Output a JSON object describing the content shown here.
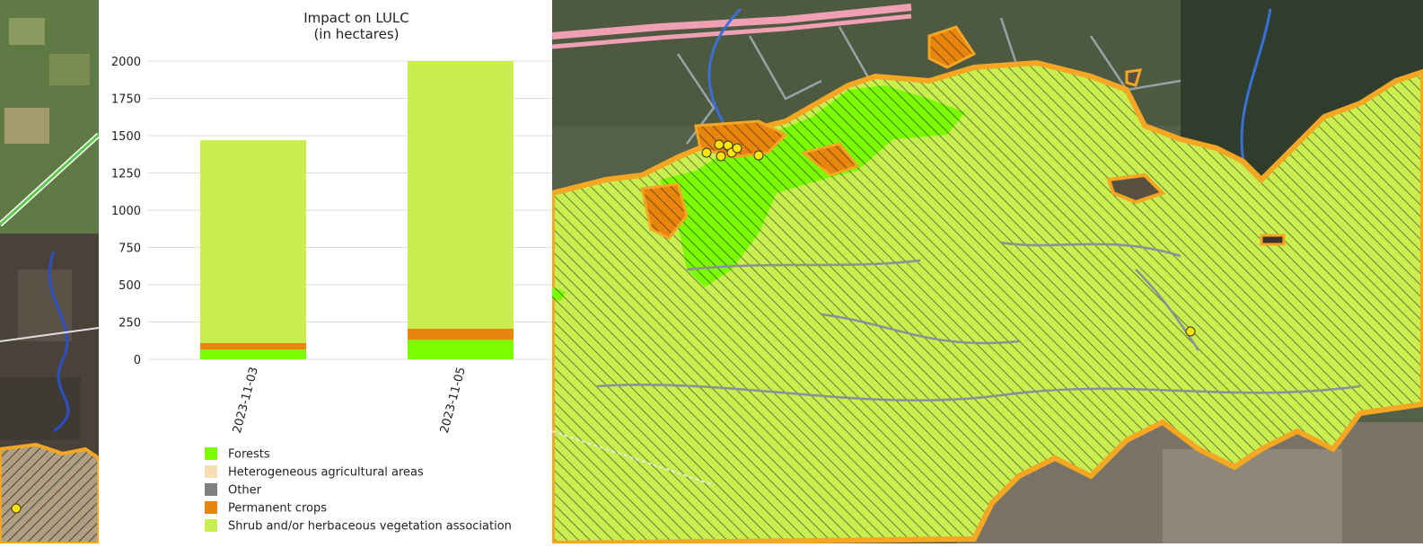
{
  "chart_data": {
    "type": "bar",
    "stacked": true,
    "title": "Impact on LULC",
    "subtitle": "(in hectares)",
    "categories": [
      "2023-11-03",
      "2023-11-05"
    ],
    "ylim": [
      0,
      2000
    ],
    "yticks": [
      0,
      250,
      500,
      750,
      1000,
      1250,
      1500,
      1750,
      2000
    ],
    "grid": true,
    "legend_position": "bottom",
    "series": [
      {
        "name": "Forests",
        "color": "#7CFC00",
        "values": [
          65,
          130
        ]
      },
      {
        "name": "Heterogeneous agricultural areas",
        "color": "#F5DEB3",
        "values": [
          0,
          0
        ]
      },
      {
        "name": "Other",
        "color": "#808080",
        "values": [
          0,
          0
        ]
      },
      {
        "name": "Permanent crops",
        "color": "#E8850C",
        "values": [
          45,
          75
        ]
      },
      {
        "name": "Shrub and/or herbaceous vegetation association",
        "color": "#C8EE50",
        "values": [
          1360,
          1795
        ]
      }
    ]
  },
  "map_colors": {
    "shrub_hatch": "#C8EE50",
    "forest": "#7CFC00",
    "permanent_crops": "#E8850C",
    "perimeter_outline": "#F5A623",
    "hotspot_point": "#FFE600",
    "river": "#3A6FD8",
    "road": "#9AA0A8",
    "highway": "#F0A0B4"
  }
}
